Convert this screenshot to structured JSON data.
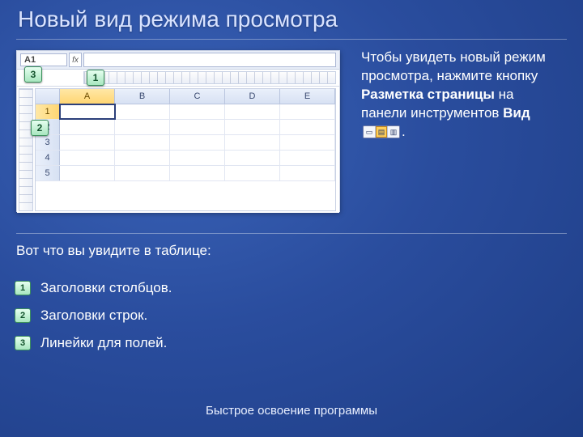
{
  "title": "Новый вид режима просмотра",
  "screenshot": {
    "cell_ref": "A1",
    "columns": [
      "A",
      "B",
      "C",
      "D",
      "E"
    ],
    "rows": [
      "1",
      "2",
      "3",
      "4",
      "5"
    ],
    "callouts": {
      "c1": "1",
      "c2": "2",
      "c3": "3"
    }
  },
  "paragraph": {
    "p1": "Чтобы увидеть новый режим просмотра, нажмите кнопку ",
    "b1": "Разметка страницы",
    "p2": " на панели инструментов ",
    "b2": "Вид",
    "p3": "."
  },
  "subheading": "Вот что вы увидите в таблице:",
  "items": [
    {
      "num": "1",
      "text": "Заголовки столбцов."
    },
    {
      "num": "2",
      "text": "Заголовки строк."
    },
    {
      "num": "3",
      "text": "Линейки для полей."
    }
  ],
  "footer": "Быстрое освоение программы"
}
